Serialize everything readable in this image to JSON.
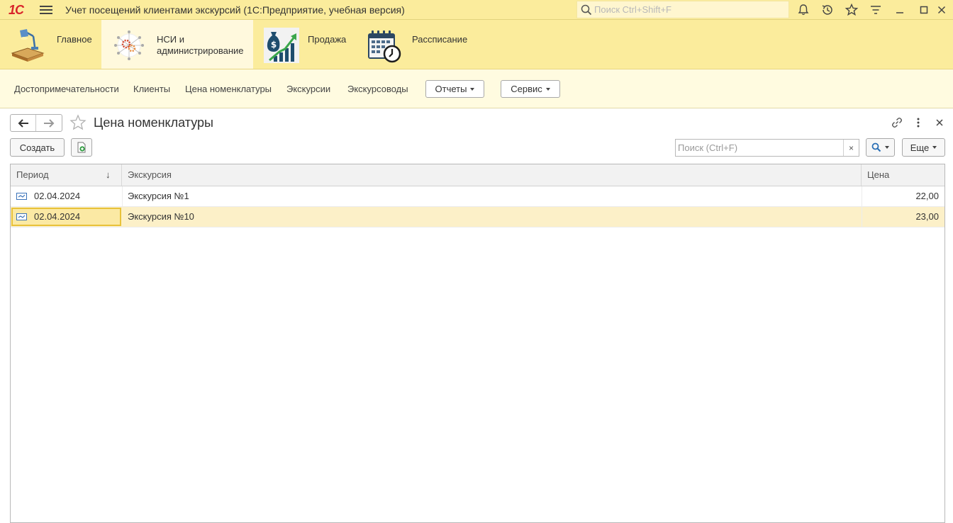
{
  "app": {
    "logo": "1С",
    "title": "Учет посещений клиентами экскурсий  (1С:Предприятие, учебная версия)",
    "search_placeholder": "Поиск Ctrl+Shift+F"
  },
  "sections": [
    {
      "label": "Главное",
      "icon": "desk-lamp-icon",
      "active": false
    },
    {
      "label": "НСИ и администрирование",
      "icon": "gears-network-icon",
      "active": true
    },
    {
      "label": "Продажа",
      "icon": "money-bag-growth-icon",
      "active": false
    },
    {
      "label": "Рассписание",
      "icon": "calendar-clock-icon",
      "active": false
    }
  ],
  "commands": {
    "links": [
      "Достопримечательности",
      "Клиенты",
      "Цена номенклатуры",
      "Экскурсии",
      "Экскурсоводы"
    ],
    "reports_label": "Отчеты",
    "service_label": "Сервис"
  },
  "form": {
    "title": "Цена номенклатуры",
    "create_label": "Создать",
    "search_placeholder": "Поиск (Ctrl+F)",
    "clear_glyph": "×",
    "more_label": "Еще"
  },
  "table": {
    "columns": [
      "Период",
      "Экскурсия",
      "Цена"
    ],
    "sort_indicator": "↓",
    "rows": [
      {
        "period": "02.04.2024",
        "excursion": "Экскурсия №1",
        "price": "22,00",
        "selected": false
      },
      {
        "period": "02.04.2024",
        "excursion": "Экскурсия №10",
        "price": "23,00",
        "selected": true
      }
    ]
  },
  "colors": {
    "header_bg": "#fbec9c",
    "commands_bg": "#fffbe0",
    "selection_bg": "#fcf0c8",
    "focus_border": "#e8c23a",
    "logo_red": "#d8232a"
  }
}
